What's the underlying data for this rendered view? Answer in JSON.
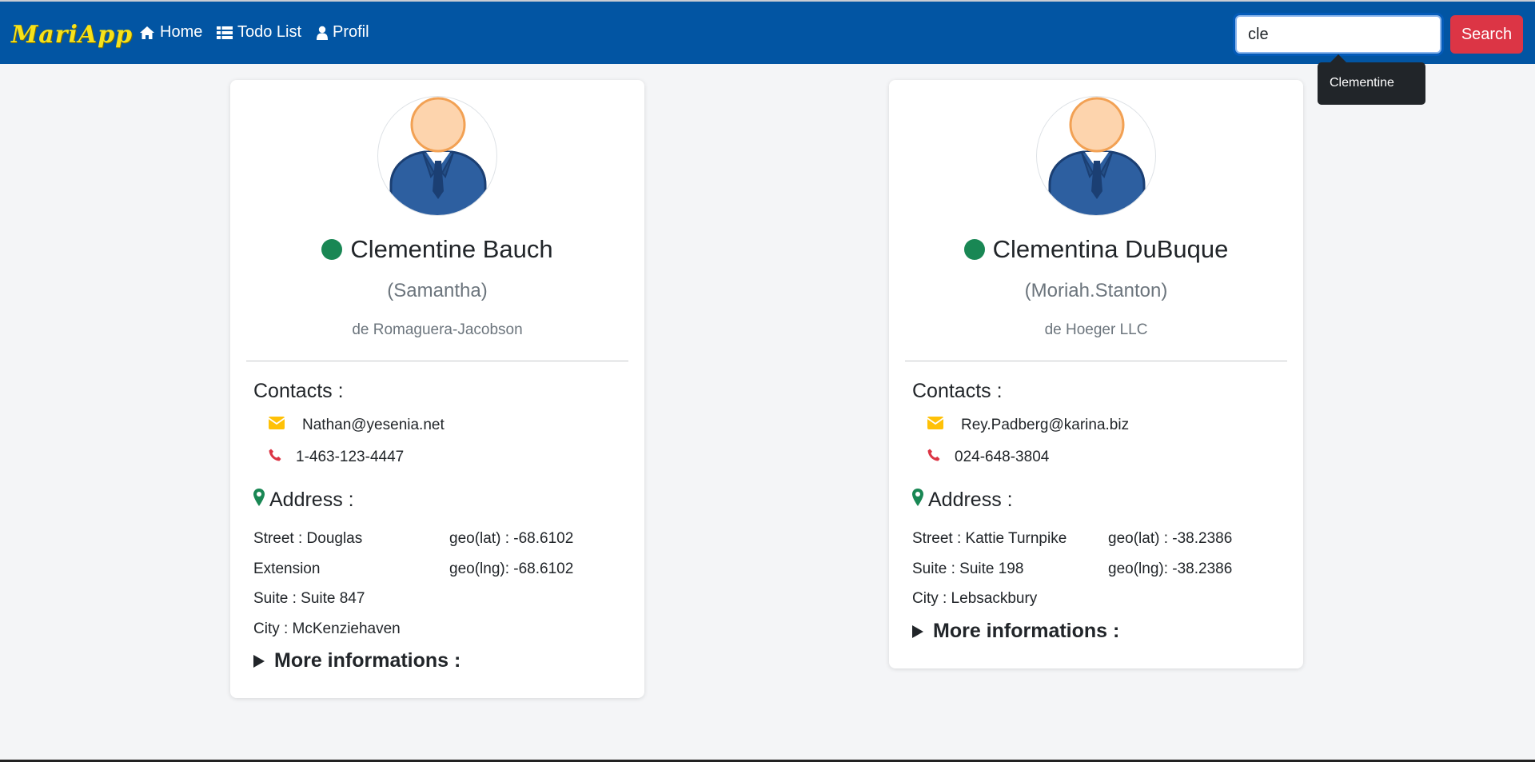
{
  "app": {
    "brand": "MariApp",
    "nav": [
      {
        "label": "Home",
        "icon": "home-icon"
      },
      {
        "label": "Todo List",
        "icon": "list-icon"
      },
      {
        "label": "Profil",
        "icon": "user-icon"
      }
    ],
    "search": {
      "value": "cle",
      "button_label": "Search"
    },
    "suggestion": "Clementine"
  },
  "colors": {
    "navbar": "#0255a3",
    "brand": "#f7e21a",
    "search_button": "#dc3545",
    "status_online": "#198754",
    "email_icon": "#ffc107",
    "phone_icon": "#dc3545",
    "address_icon": "#198754"
  },
  "cards": [
    {
      "name": "Clementine Bauch",
      "username": "(Samantha)",
      "company": "de Romaguera-Jacobson",
      "contacts_title": "Contacts :",
      "email": "Nathan@yesenia.net",
      "phone": "1-463-123-4447",
      "address_title": "Address :",
      "address_left": [
        "Street : Douglas",
        "Extension",
        "Suite : Suite 847",
        "City : McKenziehaven"
      ],
      "address_right": [
        "geo(lat) : -68.6102",
        "geo(lng): -68.6102"
      ],
      "more": "More informations :"
    },
    {
      "name": "Clementina DuBuque",
      "username": "(Moriah.Stanton)",
      "company": "de Hoeger LLC",
      "contacts_title": "Contacts :",
      "email": "Rey.Padberg@karina.biz",
      "phone": "024-648-3804",
      "address_title": "Address :",
      "address_left": [
        "Street : Kattie Turnpike",
        "Suite : Suite 198",
        "City : Lebsackbury"
      ],
      "address_right": [
        "geo(lat) : -38.2386",
        "geo(lng): -38.2386"
      ],
      "more": "More informations :"
    }
  ]
}
